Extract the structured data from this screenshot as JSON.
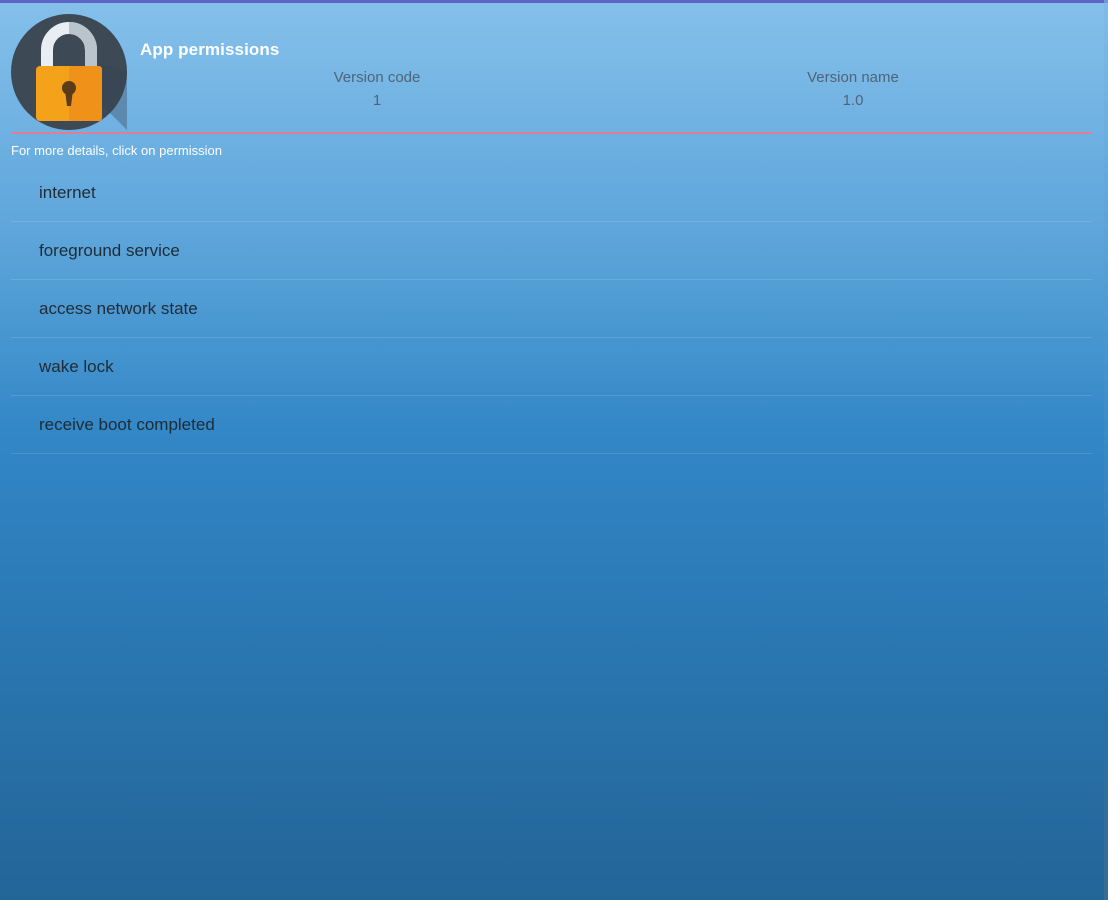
{
  "header": {
    "title": "App permissions",
    "version_code_label": "Version code",
    "version_code_value": "1",
    "version_name_label": "Version name",
    "version_name_value": "1.0",
    "icon": "padlock-icon"
  },
  "hint": "For more details, click on permission",
  "permissions": [
    {
      "label": "internet"
    },
    {
      "label": "foreground service"
    },
    {
      "label": "access network state"
    },
    {
      "label": "wake lock"
    },
    {
      "label": "receive boot completed"
    }
  ],
  "colors": {
    "accent_divider": "#e07f91",
    "padlock_body": "#f5a21b",
    "icon_background": "#3d4a56"
  }
}
